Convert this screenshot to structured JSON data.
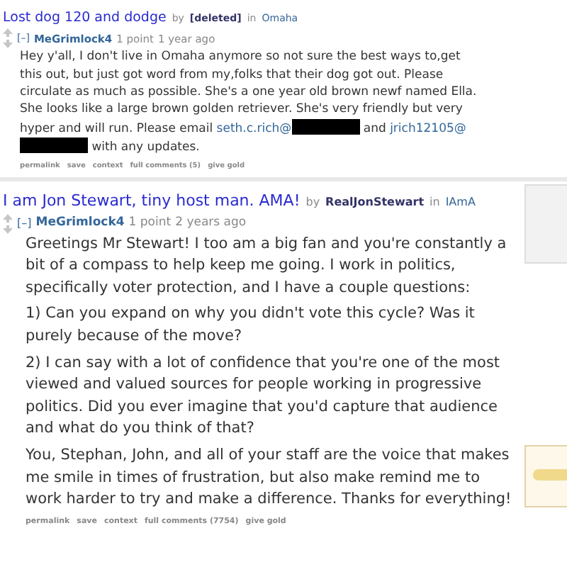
{
  "comments": [
    {
      "post_title": "Lost dog 120 and dodge",
      "by_label": "by",
      "post_author": "[deleted]",
      "in_label": "in",
      "subreddit": "Omaha",
      "collapse": "[–]",
      "user": "MeGrimlock4",
      "points": "1 point",
      "time": "1 year ago",
      "paragraphs": [
        [
          {
            "kind": "text",
            "text": "Hey y'all, I don't live in Omaha anymore so not sure the best ways to,get this out, but just got word from my,folks that their dog got out. Please circulate as much as possible. She's a one year old brown newf named Ella. She looks like a large brown golden retriever. She's very friendly but very hyper and will run. Please email "
          },
          {
            "kind": "link",
            "text": "seth.c.rich@"
          },
          {
            "kind": "redacted"
          },
          {
            "kind": "text",
            "text": " and "
          },
          {
            "kind": "link",
            "text": "jrich12105@"
          },
          {
            "kind": "redacted"
          },
          {
            "kind": "text",
            "text": " with any updates."
          }
        ]
      ],
      "actions": [
        "permalink",
        "save",
        "context",
        "full comments (5)",
        "give gold"
      ]
    },
    {
      "post_title": "I am Jon Stewart, tiny host man. AMA!",
      "by_label": "by",
      "post_author": "RealJonStewart",
      "in_label": "in",
      "subreddit": "IAmA",
      "collapse": "[–]",
      "user": "MeGrimlock4",
      "points": "1 point",
      "time": "2 years ago",
      "paragraphs": [
        [
          {
            "kind": "text",
            "text": "Greetings Mr Stewart! I too am a big fan and you're constantly a bit of a compass to help keep me going. I work in politics, specifically voter protection, and I have a couple questions:"
          }
        ],
        [
          {
            "kind": "text",
            "text": "1) Can you expand on why you didn't vote this cycle? Was it purely because of the move?"
          }
        ],
        [
          {
            "kind": "text",
            "text": "2) I can say with a lot of confidence that you're one of the most viewed and valued sources for people working in progressive politics. Did you ever imagine that you'd capture that audience and what do you think of that?"
          }
        ],
        [
          {
            "kind": "text",
            "text": "You, Stephan, John, and all of your staff are the voice that makes me smile in times of frustration, but also make remind me to work harder to try and make a difference. Thanks for everything!"
          }
        ]
      ],
      "actions": [
        "permalink",
        "save",
        "context",
        "full comments (7754)",
        "give gold"
      ]
    }
  ]
}
